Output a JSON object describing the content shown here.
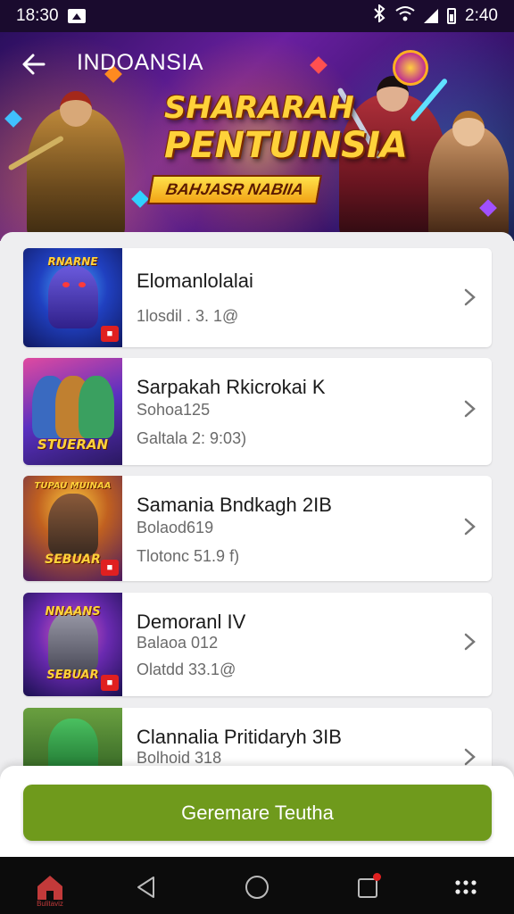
{
  "status_bar": {
    "time_left": "18:30",
    "time_right": "2:40",
    "icons": [
      "gallery-icon",
      "bluetooth-icon",
      "wifi-icon",
      "signal-icon",
      "battery-icon"
    ]
  },
  "header": {
    "back_icon": "arrow-left-icon",
    "region": "INDOANSIA"
  },
  "banner": {
    "title_line1": "SHARARAH",
    "title_line2": "PENTUINSIA",
    "tag": "BAHJASR NABIIA"
  },
  "items": [
    {
      "title": "Elomanlolalai",
      "meta1": "1losdil . 3. 1@",
      "meta2": "",
      "badge": "■"
    },
    {
      "title": "Sarpakah Rkicrokai K",
      "meta1": "Sohoa125",
      "meta2": "Galtala 2: 9:03)",
      "thumb_text": "STUERAN"
    },
    {
      "title": "Samania Bndkagh 2IB",
      "meta1": "Bolaod619",
      "meta2": "Tlotonc 51.9 f)",
      "thumb_text": "SEBUAR",
      "thumb_top": "TUPAU MUINAA",
      "badge": "■"
    },
    {
      "title": "Demoranl IV",
      "meta1": "Balaoa 012",
      "meta2": "Olatdd 33.1@",
      "thumb_text": "SEBUAR",
      "thumb_top": "NNAANS",
      "badge": "■"
    },
    {
      "title": "Clannalia Pritidaryh 3IB",
      "meta1": "Bolhoid 318",
      "meta2": ""
    }
  ],
  "first_thumb_text": "RNARNE",
  "primary_button": {
    "label": "Geremare Teutha"
  },
  "nav": {
    "home_label": "Bulitaviz",
    "items": [
      "home-icon",
      "back-triangle-icon",
      "circle-home-icon",
      "notification-square-icon",
      "apps-grid-icon"
    ]
  },
  "colors": {
    "accent_green": "#6f9a1c",
    "banner_purple": "#6a1fa0",
    "title_gold": "#ffd23a",
    "nav_home_red": "#c23a3a"
  }
}
